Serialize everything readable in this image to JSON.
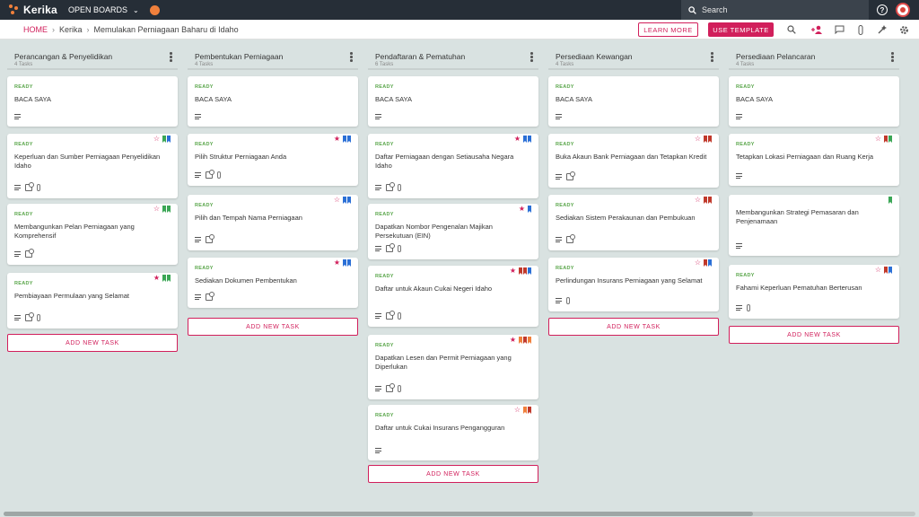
{
  "app": {
    "logo_text": "Kerika",
    "open_boards_label": "OPEN BOARDS",
    "search_placeholder": "Search",
    "help_label": "?"
  },
  "breadcrumb": {
    "home": "HOME",
    "items": [
      "Kerika",
      "Memulakan Perniagaan Baharu di Idaho"
    ]
  },
  "actions": {
    "learn_more": "LEARN MORE",
    "use_template": "USE TEMPLATE"
  },
  "toolbar_icons": [
    "search-icon",
    "add-person-icon",
    "chat-icon",
    "attachment-icon",
    "wand-icon",
    "settings-icon"
  ],
  "colors": {
    "accent": "#d11f5b",
    "ready": "#5aa64b",
    "green_tag": "#3aa655",
    "blue_tag": "#2a6fd6",
    "red_tag": "#c0392b",
    "orange_tag": "#f0803c",
    "teal_tag": "#2aa6a0"
  },
  "add_task_label": "ADD NEW TASK",
  "columns": [
    {
      "title": "Perancangan & Penyelidikan",
      "count": "4 Tasks",
      "cards": [
        {
          "status": "READY",
          "name": "BACA SAYA",
          "star": "",
          "tags": [],
          "check": "",
          "clip": false
        },
        {
          "status": "READY",
          "name": "Keperluan dan Sumber Perniagaan Penyelidikan Idaho",
          "star": "outline",
          "tags": [
            "#3aa655",
            "#2a6fd6"
          ],
          "check": "1",
          "clip": true
        },
        {
          "status": "READY",
          "name": "Membangunkan Pelan Perniagaan yang Komprehensif",
          "star": "outline",
          "tags": [
            "#3aa655",
            "#3aa655"
          ],
          "check": "1",
          "clip": false
        },
        {
          "status": "READY",
          "name": "Pembiayaan Permulaan yang Selamat",
          "star": "filled",
          "tags": [
            "#3aa655",
            "#3aa655"
          ],
          "check": "2",
          "clip": true
        }
      ]
    },
    {
      "title": "Pembentukan Perniagaan",
      "count": "4 Tasks",
      "cards": [
        {
          "status": "READY",
          "name": "BACA SAYA",
          "star": "",
          "tags": [],
          "check": "",
          "clip": false
        },
        {
          "status": "READY",
          "name": "Pilih Struktur Perniagaan Anda",
          "star": "filled",
          "tags": [
            "#2a6fd6",
            "#2a6fd6"
          ],
          "check": "1",
          "clip": true
        },
        {
          "status": "READY",
          "name": "Pilih dan Tempah Nama Perniagaan",
          "star": "outline",
          "tags": [
            "#2a6fd6",
            "#2a6fd6"
          ],
          "check": "1",
          "clip": false
        },
        {
          "status": "READY",
          "name": "Sediakan Dokumen Pembentukan",
          "star": "filled",
          "tags": [
            "#2a6fd6",
            "#2a6fd6"
          ],
          "check": "1",
          "clip": false
        }
      ]
    },
    {
      "title": "Pendaftaran & Pematuhan",
      "count": "6 Tasks",
      "cards": [
        {
          "status": "READY",
          "name": "BACA SAYA",
          "star": "",
          "tags": [],
          "check": "",
          "clip": false
        },
        {
          "status": "READY",
          "name": "Daftar Perniagaan dengan Setiausaha Negara Idaho",
          "star": "filled",
          "tags": [
            "#2a6fd6",
            "#2a6fd6"
          ],
          "check": "1",
          "clip": true
        },
        {
          "status": "READY",
          "name": "Dapatkan Nombor Pengenalan Majikan Persekutuan (EIN)",
          "star": "filled",
          "tags": [
            "#2a6fd6"
          ],
          "check": "1",
          "clip": true
        },
        {
          "status": "READY",
          "name": "Daftar untuk Akaun Cukai Negeri Idaho",
          "star": "filled",
          "tags": [
            "#c0392b",
            "#c0392b",
            "#2a6fd6"
          ],
          "check": "1",
          "clip": true
        },
        {
          "status": "READY",
          "name": "Dapatkan Lesen dan Permit Perniagaan yang Diperlukan",
          "star": "filled",
          "tags": [
            "#f0803c",
            "#c0392b",
            "#f0803c"
          ],
          "check": "1",
          "clip": true
        },
        {
          "status": "READY",
          "name": "Daftar untuk Cukai Insurans Pengangguran",
          "star": "outline",
          "tags": [
            "#f0803c",
            "#c0392b"
          ],
          "check": "",
          "clip": false
        }
      ]
    },
    {
      "title": "Persediaan Kewangan",
      "count": "4 Tasks",
      "cards": [
        {
          "status": "READY",
          "name": "BACA SAYA",
          "star": "",
          "tags": [],
          "check": "",
          "clip": false
        },
        {
          "status": "READY",
          "name": "Buka Akaun Bank Perniagaan dan Tetapkan Kredit",
          "star": "outline",
          "tags": [
            "#c0392b",
            "#c0392b"
          ],
          "check": "1",
          "clip": false
        },
        {
          "status": "READY",
          "name": "Sediakan Sistem Perakaunan dan Pembukuan",
          "star": "outline",
          "tags": [
            "#c0392b",
            "#c0392b"
          ],
          "check": "1",
          "clip": false
        },
        {
          "status": "READY",
          "name": "Perlindungan Insurans Perniagaan yang Selamat",
          "star": "outline",
          "tags": [
            "#c0392b",
            "#2a6fd6"
          ],
          "check": "",
          "clip": true
        }
      ]
    },
    {
      "title": "Persediaan Pelancaran",
      "count": "4 Tasks",
      "cards": [
        {
          "status": "READY",
          "name": "BACA SAYA",
          "star": "",
          "tags": [],
          "check": "",
          "clip": false
        },
        {
          "status": "READY",
          "name": "Tetapkan Lokasi Perniagaan dan Ruang Kerja",
          "star": "outline",
          "tags": [
            "#c0392b",
            "#3aa655"
          ],
          "check": "",
          "clip": false
        },
        {
          "status": "",
          "name": "Membangunkan Strategi Pemasaran dan Penjenamaan",
          "star": "",
          "tags": [
            "#3aa655"
          ],
          "check": "",
          "clip": false
        },
        {
          "status": "READY",
          "name": "Fahami Keperluan Pematuhan Berterusan",
          "star": "outline",
          "tags": [
            "#c0392b",
            "#2a6fd6"
          ],
          "check": "",
          "clip": true
        }
      ]
    }
  ]
}
